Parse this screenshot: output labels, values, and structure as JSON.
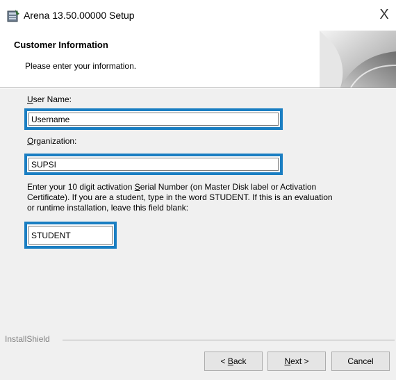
{
  "window": {
    "title": "Arena 13.50.00000  Setup",
    "close_glyph": "X",
    "icon": "installer-icon"
  },
  "banner": {
    "title": "Customer Information",
    "subtitle": "Please enter your information."
  },
  "form": {
    "username_label_accel": "U",
    "username_label_rest": "ser Name:",
    "username_value": "Username",
    "organization_label_accel": "O",
    "organization_label_rest": "rganization:",
    "organization_value": "SUPSI",
    "serial_info_part1": "Enter your 10 digit activation ",
    "serial_info_accel": "S",
    "serial_info_part2": "erial Number (on Master Disk label or Activation Certificate).  If you are a student, type in the word STUDENT.  If this is an evaluation or runtime installation, leave this field blank:",
    "serial_value": "STUDENT"
  },
  "footer": {
    "brand": "InstallShield",
    "back_prefix": "< ",
    "back_accel": "B",
    "back_rest": "ack",
    "next_accel": "N",
    "next_rest": "ext >",
    "cancel_label": "Cancel"
  },
  "colors": {
    "highlight_border": "#1a7ec2",
    "panel_bg": "#f0f0f0"
  }
}
